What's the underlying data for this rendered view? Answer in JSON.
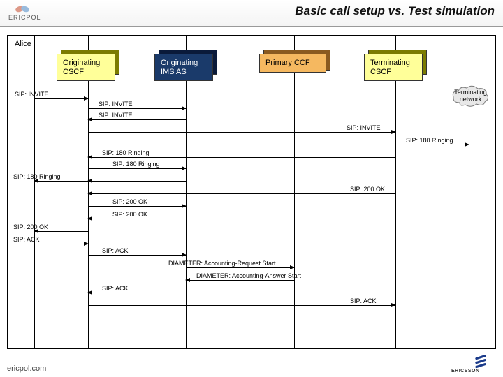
{
  "header": {
    "brand": "ERICPOL",
    "title": "Basic call setup vs. Test simulation"
  },
  "actors": {
    "alice": "Alice",
    "orig_cscf": "Originating\nCSCF",
    "orig_ims_as": "Originating\nIMS AS",
    "primary_ccf": "Primary CCF",
    "term_cscf": "Terminating\nCSCF",
    "term_net": "Terminating\nnetwork"
  },
  "messages": {
    "invite": "SIP: INVITE",
    "ringing": "SIP: 180 Ringing",
    "ok": "SIP: 200 OK",
    "ack": "SIP: ACK",
    "diam_req": "DIAMETER: Accounting-Request Start",
    "diam_ans": "DIAMETER: Accounting-Answer Start"
  },
  "footer": {
    "url": "ericpol.com",
    "ericsson": "ERICSSON"
  },
  "chart_data": {
    "type": "sequence-diagram",
    "title": "Basic call setup vs. Test simulation",
    "participants": [
      "Alice",
      "Originating CSCF",
      "Originating IMS AS",
      "Primary CCF",
      "Terminating CSCF",
      "Terminating network"
    ],
    "messages": [
      {
        "from": "Alice",
        "to": "Originating CSCF",
        "label": "SIP: INVITE"
      },
      {
        "from": "Originating CSCF",
        "to": "Originating IMS AS",
        "label": "SIP: INVITE"
      },
      {
        "from": "Originating IMS AS",
        "to": "Originating CSCF",
        "label": "SIP: INVITE"
      },
      {
        "from": "Originating CSCF",
        "to": "Terminating CSCF",
        "label": "SIP: INVITE"
      },
      {
        "from": "Terminating CSCF",
        "to": "Terminating network",
        "label": "SIP: 180 Ringing"
      },
      {
        "from": "Terminating CSCF",
        "to": "Originating CSCF",
        "label": "SIP: 180 Ringing"
      },
      {
        "from": "Originating CSCF",
        "to": "Originating IMS AS",
        "label": "SIP: 180 Ringing"
      },
      {
        "from": "Originating IMS AS",
        "to": "Originating CSCF",
        "label": "SIP: 180 Ringing"
      },
      {
        "from": "Originating CSCF",
        "to": "Alice",
        "label": "SIP: 180 Ringing"
      },
      {
        "from": "Terminating CSCF",
        "to": "Originating CSCF",
        "label": "SIP: 200 OK"
      },
      {
        "from": "Originating CSCF",
        "to": "Originating IMS AS",
        "label": "SIP: 200 OK"
      },
      {
        "from": "Originating IMS AS",
        "to": "Originating CSCF",
        "label": "SIP: 200 OK"
      },
      {
        "from": "Originating CSCF",
        "to": "Alice",
        "label": "SIP: 200 OK"
      },
      {
        "from": "Alice",
        "to": "Originating CSCF",
        "label": "SIP: ACK"
      },
      {
        "from": "Originating CSCF",
        "to": "Originating IMS AS",
        "label": "SIP: ACK"
      },
      {
        "from": "Originating IMS AS",
        "to": "Primary CCF",
        "label": "DIAMETER: Accounting-Request Start"
      },
      {
        "from": "Primary CCF",
        "to": "Originating IMS AS",
        "label": "DIAMETER: Accounting-Answer Start"
      },
      {
        "from": "Originating IMS AS",
        "to": "Originating CSCF",
        "label": "SIP: ACK"
      },
      {
        "from": "Originating CSCF",
        "to": "Terminating CSCF",
        "label": "SIP: ACK"
      }
    ]
  }
}
